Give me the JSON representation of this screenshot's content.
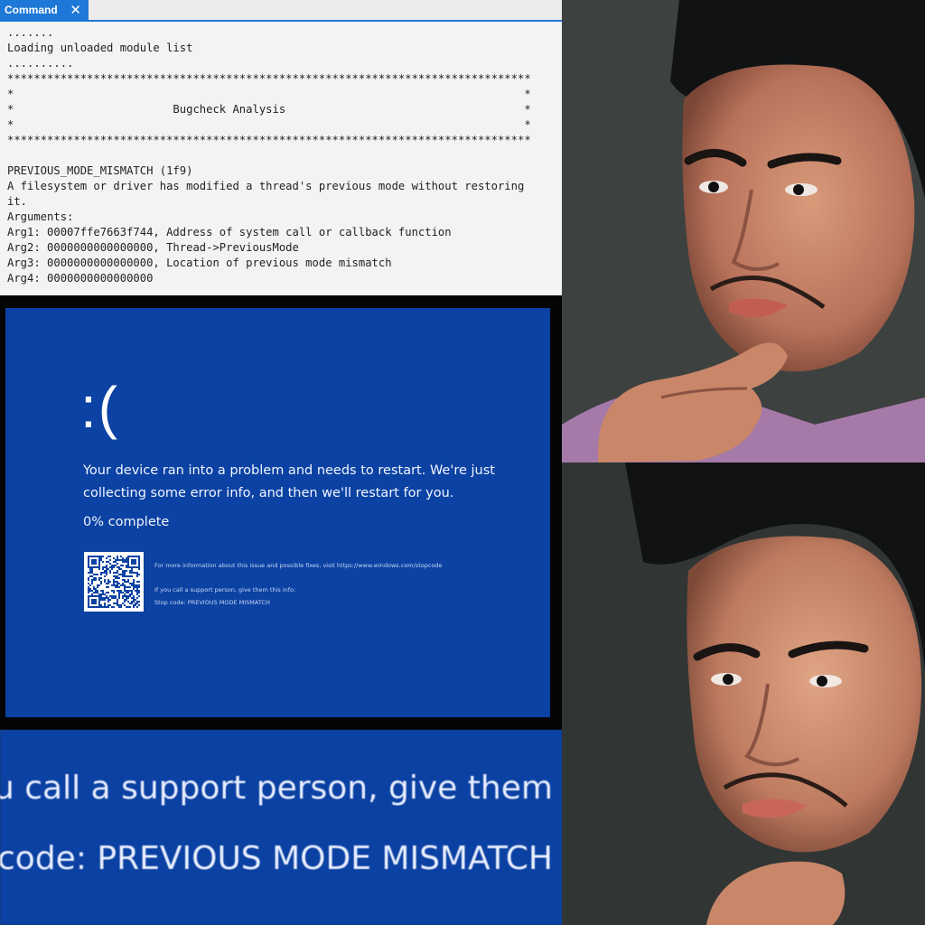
{
  "command_window": {
    "tab_label": "Command",
    "close_glyph": "✕",
    "lines": [
      ".......",
      "Loading unloaded module list",
      "..........",
      "*******************************************************************************",
      "*                                                                             *",
      "*                        Bugcheck Analysis                                    *",
      "*                                                                             *",
      "*******************************************************************************",
      "",
      "PREVIOUS_MODE_MISMATCH (1f9)",
      "A filesystem or driver has modified a thread's previous mode without restoring",
      "it.",
      "Arguments:",
      "Arg1: 00007ffe7663f744, Address of system call or callback function",
      "Arg2: 0000000000000000, Thread->PreviousMode",
      "Arg3: 0000000000000000, Location of previous mode mismatch",
      "Arg4: 0000000000000000"
    ]
  },
  "bsod": {
    "sad_face": ":(",
    "message": "Your device ran into a problem and needs to restart. We're just collecting some error info, and then we'll restart for you.",
    "progress": "0% complete",
    "progress_value": 0,
    "more_info": "For more information about this issue and possible fixes, visit https://www.windows.com/stopcode",
    "support_line": "If you call a support person, give them this info:",
    "stop_code": "Stop code: PREVIOUS MODE MISMATCH",
    "background_color": "#0b42a3"
  },
  "zoom": {
    "line1": "u call a support person, give them this info:",
    "line2": "code: PREVIOUS  MODE  MISMATCH"
  },
  "colors": {
    "accent": "#1e78d7",
    "bsod_blue": "#0b42a3"
  }
}
